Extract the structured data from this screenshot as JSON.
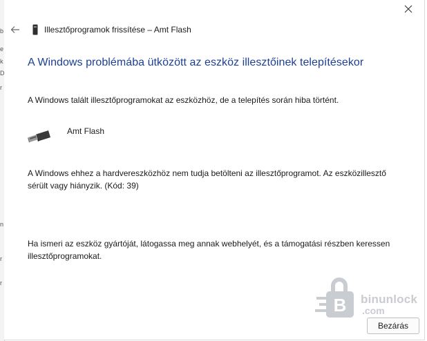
{
  "dialog": {
    "window_title": "Illesztőprogramok frissítése – Amt Flash",
    "heading": "A Windows problémába ütközött az eszköz illesztőinek telepítésekor",
    "intro_text": "A Windows talált illesztőprogramokat az eszközhöz, de a telepítés során hiba történt.",
    "device_name": "Amt Flash",
    "error_line1": "A Windows ehhez a hardvereszközhöz nem tudja betölteni az illesztőprogramot. Az eszközillesztő",
    "error_line2": "sérült vagy hiányzik. (Kód: 39)",
    "help_line1": "Ha ismeri az eszköz gyártóját, látogassa meg annak webhelyét, és a támogatási részben keressen",
    "help_line2": "illesztőprogramokat.",
    "close_button_label": "Bezárás",
    "heading_color": "#1c3f94"
  },
  "watermark": {
    "text_main": "binunlock",
    "text_sub": ".com"
  },
  "background": {
    "edge_glyphs": [
      "b",
      "e",
      "k",
      "D",
      "r",
      "n",
      "r",
      "r"
    ]
  },
  "icons": {
    "close": "close-icon",
    "back": "back-arrow-icon",
    "device": "device-icon",
    "usb": "usb-device-icon",
    "watermark": "padlock-logo-icon"
  }
}
